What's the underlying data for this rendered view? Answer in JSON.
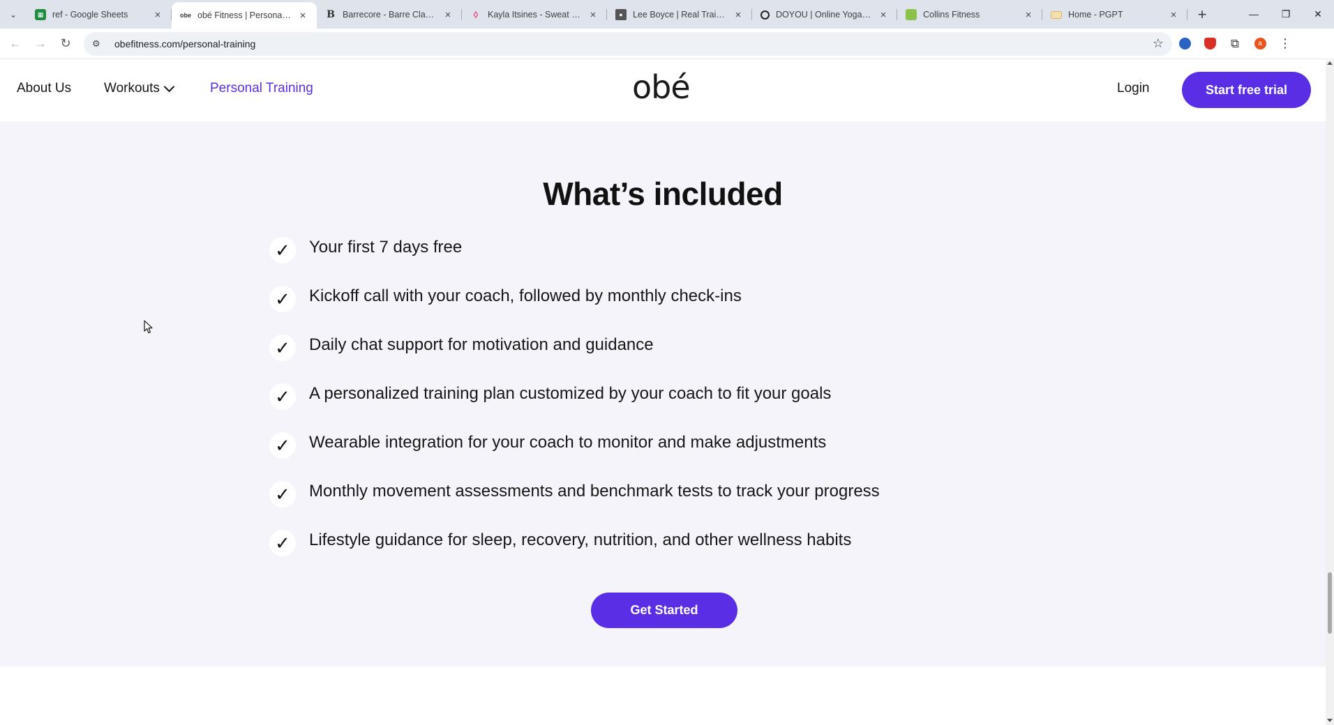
{
  "browser": {
    "tabs": [
      {
        "title": "ref - Google Sheets",
        "icon": "sheets-icon",
        "color": "#1e8e3e",
        "active": false
      },
      {
        "title": "obé Fitness | Personalized",
        "icon": "obe-favicon",
        "color": "#333333",
        "active": true
      },
      {
        "title": "Barrecore - Barre Classes",
        "icon": "barrecore-favicon",
        "color": "#333333",
        "active": false
      },
      {
        "title": "Kayla Itsines - Sweat Co-F",
        "icon": "sweat-favicon",
        "color": "#e7467f",
        "active": false
      },
      {
        "title": "Lee Boyce | Real Training.",
        "icon": "lee-boyce-favicon",
        "color": "#222222",
        "active": false
      },
      {
        "title": "DOYOU | Online Yoga, Fit",
        "icon": "doyou-favicon",
        "color": "#222222",
        "active": false
      },
      {
        "title": "Collins Fitness",
        "icon": "collins-favicon",
        "color": "#8bc34a",
        "active": false
      },
      {
        "title": "Home - PGPT",
        "icon": "pgpt-favicon",
        "color": "#d9b26a",
        "active": false
      }
    ],
    "url": "obefitness.com/personal-training"
  },
  "site": {
    "nav": {
      "about": "About Us",
      "workouts": "Workouts",
      "personal_training": "Personal Training",
      "logo": "obé",
      "login": "Login",
      "trial": "Start free trial"
    },
    "section": {
      "title": "What’s included",
      "features": [
        "Your first 7 days free",
        "Kickoff call with your coach, followed by monthly check-ins",
        "Daily chat support for motivation and guidance",
        "A personalized training plan customized by your coach to fit your goals",
        "Wearable integration for your coach to monitor and make adjustments",
        "Monthly movement assessments and benchmark tests to track your progress",
        "Lifestyle guidance for sleep, recovery, nutrition, and other wellness habits"
      ],
      "cta": "Get Started"
    }
  },
  "colors": {
    "accent": "#5a2ee5",
    "section_bg": "#f5f4fb"
  }
}
